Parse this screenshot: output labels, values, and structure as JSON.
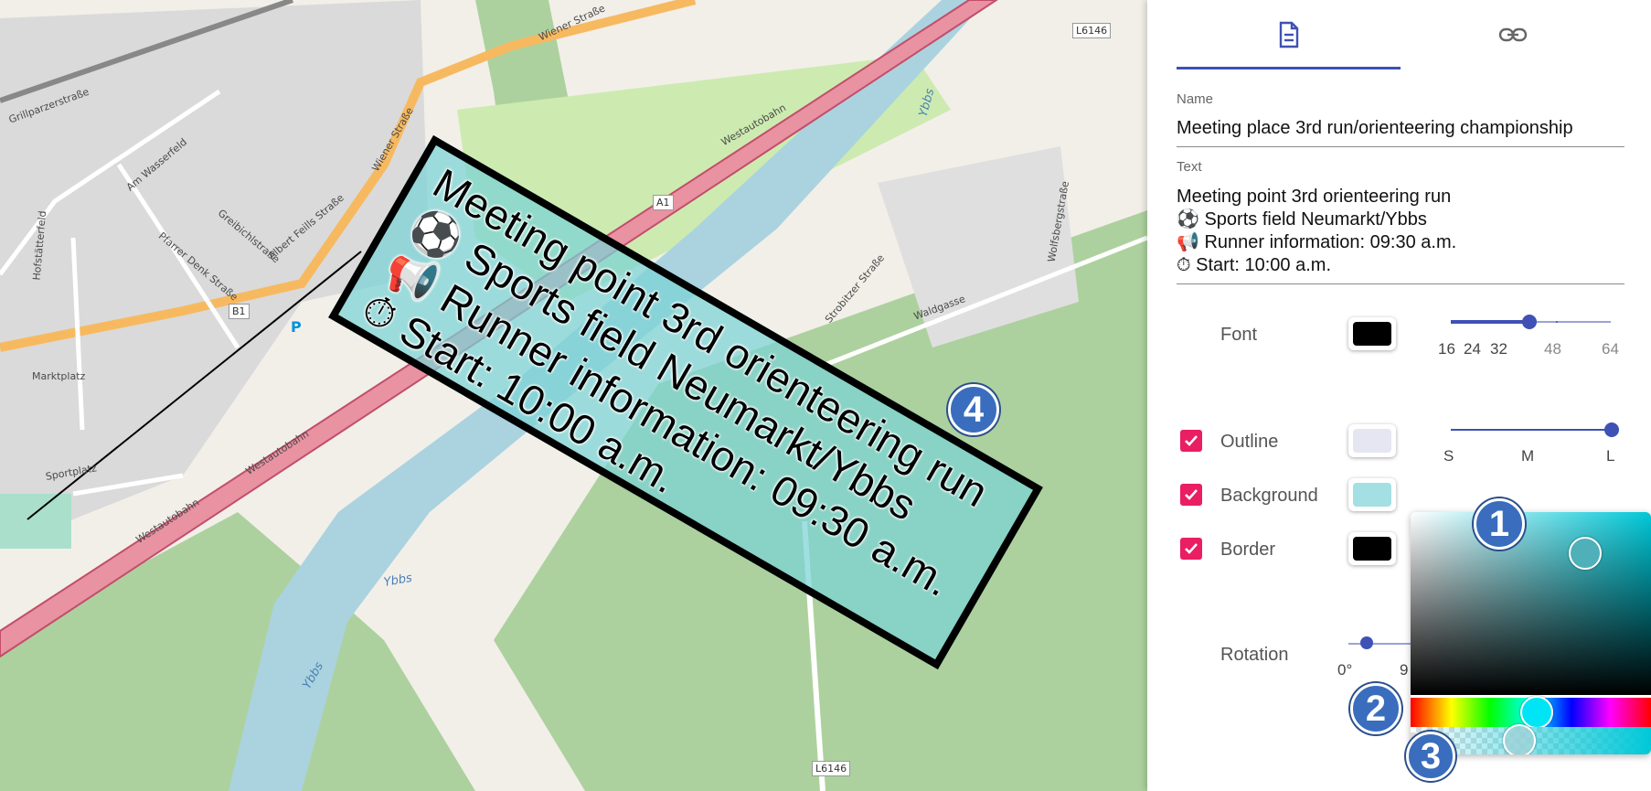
{
  "map": {
    "road_labels": [
      "Wiener Straße",
      "Westautobahn",
      "Wiener Straße",
      "Westautobahn",
      "Westautobahn",
      "Grillparzerstraße",
      "Marktplatz",
      "Sportplatz",
      "Wolfsbergstraße",
      "Strobitzer Straße",
      "Waldgasse",
      "Hofstätterfeld",
      "Am Wasserfeld",
      "Pfarrer Denk Straße",
      "Albert Feills Straße",
      "Greibichlstraße"
    ],
    "river_labels": [
      "Ybbs",
      "Ybbs",
      "Ybbs"
    ],
    "shields": [
      "L6146",
      "L6146",
      "A1",
      "B1"
    ],
    "parking": "P"
  },
  "callout": {
    "lines": [
      "Meeting point 3rd orienteering run",
      "⚽ Sports field Neumarkt/Ybbs",
      "📢 Runner information: 09:30 a.m.",
      "⏱ Start: 10:00 a.m."
    ]
  },
  "badges": {
    "b1": "1",
    "b2": "2",
    "b3": "3",
    "b4": "4"
  },
  "panel": {
    "tabs": [
      {
        "icon": "document-icon"
      },
      {
        "icon": "link-icon"
      }
    ],
    "name_label": "Name",
    "name_value": "Meeting place 3rd run/orienteering championship",
    "text_label": "Text",
    "text_lines": [
      "Meeting point 3rd orienteering run",
      "⚽ Sports field Neumarkt/Ybbs",
      "📢 Runner information: 09:30 a.m.",
      "⏱ Start: 10:00 a.m."
    ],
    "font_label": "Font",
    "font_color": "#000000",
    "font_sizes": [
      "16",
      "24",
      "32",
      "48",
      "64"
    ],
    "font_size_selected": "40",
    "outline_label": "Outline",
    "outline_color": "#e6e6f2",
    "outline_sizes": [
      "S",
      "M",
      "L"
    ],
    "outline_selected": "L",
    "background_label": "Background",
    "background_color": "#a3dfe3",
    "border_label": "Border",
    "border_color": "#000000",
    "rotation_label": "Rotation",
    "rotation_ticks": [
      "0°",
      "9"
    ],
    "accent": "#3f51b5",
    "checkbox_color": "#e91e63"
  },
  "picker": {
    "hue_color": "#00c8d8"
  }
}
